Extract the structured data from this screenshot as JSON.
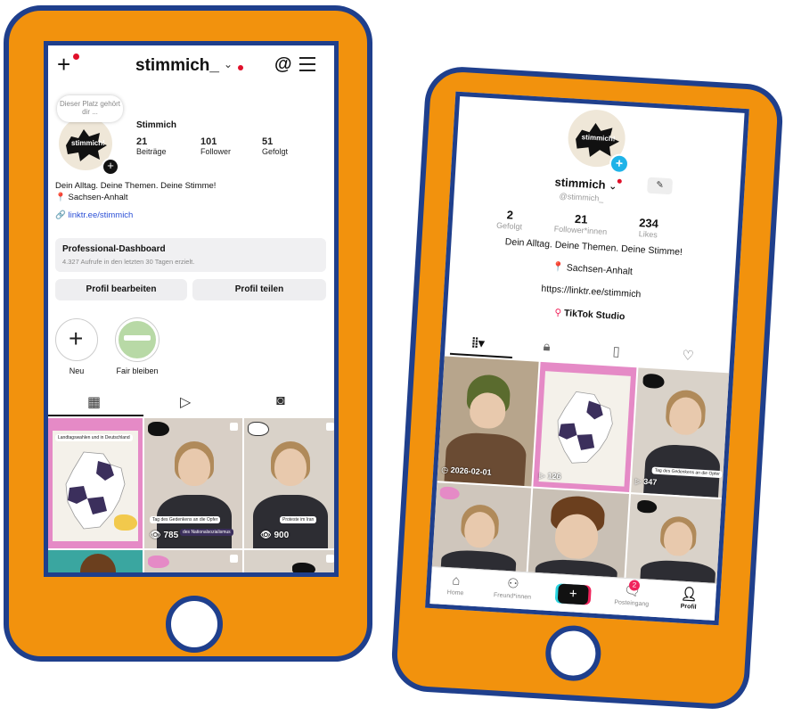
{
  "instagram": {
    "username": "stimmich_",
    "note_bubble": "Dieser Platz gehört dir ...",
    "avatar_text": "stimmich!",
    "display_name": "Stimmich",
    "stats": [
      {
        "value": "21",
        "label": "Beiträge"
      },
      {
        "value": "101",
        "label": "Follower"
      },
      {
        "value": "51",
        "label": "Gefolgt"
      }
    ],
    "bio_line1": "Dein Alltag. Deine Themen. Deine Stimme!",
    "bio_location": "Sachsen-Anhalt",
    "bio_link": "linktr.ee/stimmich",
    "dashboard_title": "Professional-Dashboard",
    "dashboard_sub": "4.327 Aufrufe in den letzten 30 Tagen erzielt.",
    "btn_edit": "Profil bearbeiten",
    "btn_share": "Profil teilen",
    "highlight_new": "Neu",
    "highlight_fair": "Fair bleiben",
    "tiles": {
      "map_caption": "Landtagswahlen und in Deutschland",
      "t2_caption": "Tag des Gedenkens an die Opfer",
      "t2_sub": "des Nationalsozialismus",
      "t2_views": "785",
      "t3_caption": "Proteste im Iran",
      "t3_views": "900"
    }
  },
  "tiktok": {
    "avatar_text": "stimmich!",
    "username": "stimmich",
    "handle": "@stimmich_",
    "stats": [
      {
        "value": "2",
        "label": "Gefolgt"
      },
      {
        "value": "21",
        "label": "Follower*innen"
      },
      {
        "value": "234",
        "label": "Likes"
      }
    ],
    "bio_line1": "Dein Alltag. Deine Themen. Deine Stimme!",
    "bio_location": "Sachsen-Anhalt",
    "bio_link": "https://linktr.ee/stimmich",
    "studio": "TikTok Studio",
    "tiles": {
      "t1_date": "2026-02-01",
      "t2_views": "126",
      "t3_caption": "Tag des Gedenkens an die Opfer",
      "t3_views": "347"
    },
    "nav": {
      "home": "Home",
      "friends": "Freund*innen",
      "inbox": "Posteingang",
      "inbox_badge": "2",
      "profile": "Profil"
    }
  },
  "colors": {
    "frame_orange": "#f2920d",
    "frame_blue": "#1f3f8c",
    "notification_red": "#e0102a",
    "tiktok_pink": "#f0245c",
    "tiktok_cyan": "#2ad4e0"
  }
}
